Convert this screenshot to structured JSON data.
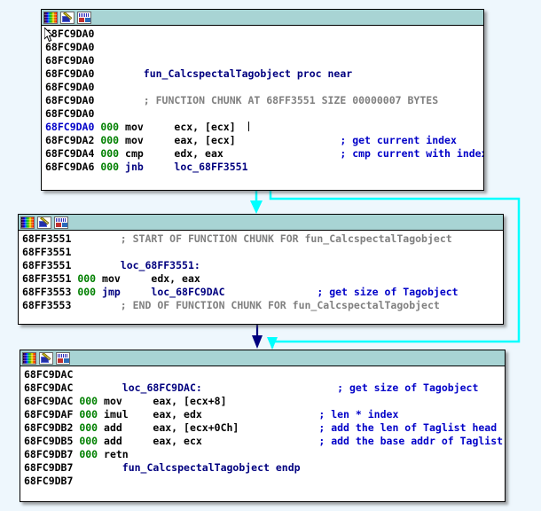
{
  "app": {
    "name": "IDA Pro graph view",
    "background_color": "#eef7fd",
    "titlebar_color": "#a8d4d4",
    "colors": {
      "address": "#000000",
      "current_address": "#0000c8",
      "stack_delta": "#008000",
      "comment": "#0000c8",
      "auto_comment": "#808080",
      "label": "#00007f",
      "arrow_jump": "#00ffff",
      "arrow_flow": "#00007f"
    }
  },
  "toolbar": {
    "icons": [
      {
        "name": "palette-icon",
        "label": "color-palette"
      },
      {
        "name": "edit-icon",
        "label": "edit-function"
      },
      {
        "name": "graph-icon",
        "label": "graph-view"
      }
    ]
  },
  "nodes": [
    {
      "id": "node-top",
      "lines": [
        {
          "addr": "68FC9DA0",
          "addr_style": "addr",
          "stack": "",
          "text": "",
          "text_style": "mn",
          "comment": "",
          "comment_style": "cmt"
        },
        {
          "addr": "68FC9DA0",
          "addr_style": "addr",
          "stack": "",
          "text": "",
          "text_style": "mn",
          "comment": "",
          "comment_style": "cmt"
        },
        {
          "addr": "68FC9DA0",
          "addr_style": "addr",
          "stack": "",
          "text": "",
          "text_style": "mn",
          "comment": "",
          "comment_style": "cmt"
        },
        {
          "addr": "68FC9DA0",
          "addr_style": "addr",
          "stack": "",
          "text": "fun_CalcspectalTagobject proc near",
          "text_style": "fn",
          "comment": "",
          "comment_style": "cmt"
        },
        {
          "addr": "68FC9DA0",
          "addr_style": "addr",
          "stack": "",
          "text": "",
          "text_style": "mn",
          "comment": "",
          "comment_style": "cmt"
        },
        {
          "addr": "68FC9DA0",
          "addr_style": "addr",
          "stack": "",
          "text": "; FUNCTION CHUNK AT 68FF3551 SIZE 00000007 BYTES",
          "text_style": "gcmt",
          "comment": "",
          "comment_style": "cmt"
        },
        {
          "addr": "68FC9DA0",
          "addr_style": "addr",
          "stack": "",
          "text": "",
          "text_style": "mn",
          "comment": "",
          "comment_style": "cmt"
        },
        {
          "addr": "68FC9DA0",
          "addr_style": "addr cur",
          "stack": "000",
          "text": "mov     ecx, [ecx]",
          "text_style": "mn",
          "comment": "",
          "comment_style": "cmt",
          "caret": true
        },
        {
          "addr": "68FC9DA2",
          "addr_style": "addr",
          "stack": "000",
          "text": "mov     eax, [ecx]",
          "text_style": "mn",
          "comment": "; get current index",
          "comment_style": "cmt"
        },
        {
          "addr": "68FC9DA4",
          "addr_style": "addr",
          "stack": "000",
          "text": "cmp     edx, eax",
          "text_style": "mn",
          "comment": "; cmp current with index",
          "comment_style": "cmt"
        },
        {
          "addr": "68FC9DA6",
          "addr_style": "addr",
          "stack": "000",
          "text": "jnb     loc_68FF3551",
          "text_style": "lbl",
          "comment": "",
          "comment_style": "cmt"
        }
      ]
    },
    {
      "id": "node-middle",
      "lines": [
        {
          "addr": "68FF3551",
          "addr_style": "addr",
          "stack": "",
          "text": "; START OF FUNCTION CHUNK FOR fun_CalcspectalTagobject",
          "text_style": "gcmt",
          "comment": "",
          "comment_style": "cmt"
        },
        {
          "addr": "68FF3551",
          "addr_style": "addr",
          "stack": "",
          "text": "",
          "text_style": "mn",
          "comment": "",
          "comment_style": "cmt"
        },
        {
          "addr": "68FF3551",
          "addr_style": "addr",
          "stack": "",
          "text": "loc_68FF3551:",
          "text_style": "lbl",
          "comment": "",
          "comment_style": "cmt"
        },
        {
          "addr": "68FF3551",
          "addr_style": "addr",
          "stack": "000",
          "text": "mov     edx, eax",
          "text_style": "mn",
          "comment": "",
          "comment_style": "cmt"
        },
        {
          "addr": "68FF3553",
          "addr_style": "addr",
          "stack": "000",
          "text": "jmp     loc_68FC9DAC",
          "text_style": "lbl",
          "comment": "; get size of Tagobject",
          "comment_style": "cmt"
        },
        {
          "addr": "68FF3553",
          "addr_style": "addr",
          "stack": "",
          "text": "; END OF FUNCTION CHUNK FOR fun_CalcspectalTagobject",
          "text_style": "gcmt",
          "comment": "",
          "comment_style": "cmt"
        }
      ]
    },
    {
      "id": "node-bottom",
      "lines": [
        {
          "addr": "68FC9DAC",
          "addr_style": "addr",
          "stack": "",
          "text": "",
          "text_style": "mn",
          "comment": "",
          "comment_style": "cmt"
        },
        {
          "addr": "68FC9DAC",
          "addr_style": "addr",
          "stack": "",
          "text": "loc_68FC9DAC:",
          "text_style": "lbl",
          "comment": "; get size of Tagobject",
          "comment_style": "cmt"
        },
        {
          "addr": "68FC9DAC",
          "addr_style": "addr",
          "stack": "000",
          "text": "mov     eax, [ecx+8]",
          "text_style": "mn",
          "comment": "",
          "comment_style": "cmt"
        },
        {
          "addr": "68FC9DAF",
          "addr_style": "addr",
          "stack": "000",
          "text": "imul    eax, edx",
          "text_style": "mn",
          "comment": "; len * index",
          "comment_style": "cmt"
        },
        {
          "addr": "68FC9DB2",
          "addr_style": "addr",
          "stack": "000",
          "text": "add     eax, [ecx+0Ch]",
          "text_style": "mn",
          "comment": "; add the len of Taglist head",
          "comment_style": "cmt"
        },
        {
          "addr": "68FC9DB5",
          "addr_style": "addr",
          "stack": "000",
          "text": "add     eax, ecx",
          "text_style": "mn",
          "comment": "; add the base addr of Taglist",
          "comment_style": "cmt"
        },
        {
          "addr": "68FC9DB7",
          "addr_style": "addr",
          "stack": "000",
          "text": "retn",
          "text_style": "mn",
          "comment": "",
          "comment_style": "cmt"
        },
        {
          "addr": "68FC9DB7",
          "addr_style": "addr",
          "stack": "",
          "text": "fun_CalcspectalTagobject endp",
          "text_style": "fn",
          "comment": "",
          "comment_style": "cmt"
        },
        {
          "addr": "68FC9DB7",
          "addr_style": "addr",
          "stack": "",
          "text": "",
          "text_style": "mn",
          "comment": "",
          "comment_style": "cmt"
        }
      ]
    }
  ],
  "edges": [
    {
      "name": "edge-top-to-middle",
      "type": "jump",
      "color": "#00ffff"
    },
    {
      "name": "edge-top-to-bottom",
      "type": "jump",
      "color": "#00ffff"
    },
    {
      "name": "edge-middle-to-bottom",
      "type": "flow",
      "color": "#00007f"
    }
  ]
}
